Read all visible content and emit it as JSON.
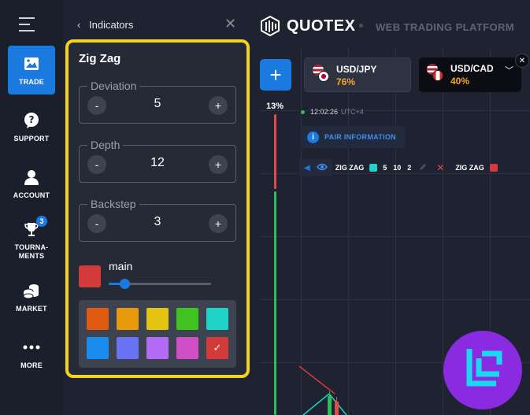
{
  "nav": {
    "items": [
      {
        "label": "TRADE",
        "icon": "chart-image-icon",
        "active": true
      },
      {
        "label": "SUPPORT",
        "icon": "question-bubble-icon"
      },
      {
        "label": "ACCOUNT",
        "icon": "user-icon"
      },
      {
        "label": "TOURNA-\nMENTS",
        "icon": "trophy-icon",
        "badge": "3"
      },
      {
        "label": "MARKET",
        "icon": "coins-icon"
      },
      {
        "label": "MORE",
        "icon": "more-dots-icon"
      }
    ]
  },
  "panel": {
    "title": "Indicators",
    "indicator_name": "Zig Zag",
    "fields": [
      {
        "label": "Deviation",
        "value": "5"
      },
      {
        "label": "Depth",
        "value": "12"
      },
      {
        "label": "Backstep",
        "value": "3"
      }
    ],
    "minus": "-",
    "plus": "+",
    "line": {
      "label": "main",
      "color": "#d33a3a",
      "width_fraction": 0.15
    },
    "palette": [
      "#e05a10",
      "#e69a0c",
      "#e3c411",
      "#3fc31e",
      "#1fd3c6",
      "#1a8cf0",
      "#6a73f3",
      "#b36cf5",
      "#d04fc6",
      "#d33a3a"
    ],
    "selected_check": "✓"
  },
  "header": {
    "brand": "QUOTEX",
    "platform": "WEB TRADING PLATFORM"
  },
  "assets": [
    {
      "name": "USD/JPY",
      "pct": "76%"
    },
    {
      "name": "USD/CAD",
      "pct": "40%"
    }
  ],
  "add_label": "+",
  "sentiment": {
    "pct": "13%",
    "up_fraction": 0.87
  },
  "clock": {
    "time": "12:02:26",
    "tz": "UTC+4"
  },
  "pair_info": "PAIR INFORMATION",
  "indicator_row": {
    "name": "ZIG ZAG",
    "params": [
      "5",
      "10",
      "2"
    ],
    "color1": "#1fd3c6",
    "name2": "ZIG ZAG",
    "color2": "#d33a3a"
  }
}
